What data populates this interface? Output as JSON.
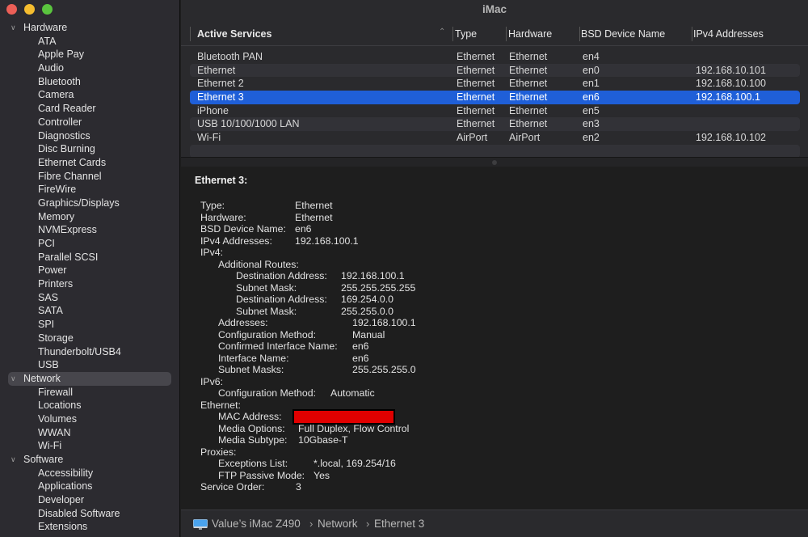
{
  "window": {
    "title": "iMac",
    "traffic_lights": {
      "close": "#ec5f57",
      "minimize": "#f5bd2f",
      "maximize": "#5ac43e"
    }
  },
  "sidebar": {
    "groups": [
      {
        "label": "Hardware",
        "expanded": true,
        "items": [
          "ATA",
          "Apple Pay",
          "Audio",
          "Bluetooth",
          "Camera",
          "Card Reader",
          "Controller",
          "Diagnostics",
          "Disc Burning",
          "Ethernet Cards",
          "Fibre Channel",
          "FireWire",
          "Graphics/Displays",
          "Memory",
          "NVMExpress",
          "PCI",
          "Parallel SCSI",
          "Power",
          "Printers",
          "SAS",
          "SATA",
          "SPI",
          "Storage",
          "Thunderbolt/USB4",
          "USB"
        ]
      },
      {
        "label": "Network",
        "expanded": true,
        "selected": true,
        "items": [
          "Firewall",
          "Locations",
          "Volumes",
          "WWAN",
          "Wi-Fi"
        ]
      },
      {
        "label": "Software",
        "expanded": true,
        "items": [
          "Accessibility",
          "Applications",
          "Developer",
          "Disabled Software",
          "Extensions"
        ]
      }
    ],
    "chevron_icon": "chevron-down-icon"
  },
  "table": {
    "columns": [
      "Active Services",
      "Type",
      "Hardware",
      "BSD Device Name",
      "IPv4 Addresses"
    ],
    "sort_indicator": "⌃",
    "rows": [
      [
        "Bluetooth PAN",
        "Ethernet",
        "Ethernet",
        "en4",
        ""
      ],
      [
        "Ethernet",
        "Ethernet",
        "Ethernet",
        "en0",
        "192.168.10.101"
      ],
      [
        "Ethernet 2",
        "Ethernet",
        "Ethernet",
        "en1",
        "192.168.10.100"
      ],
      [
        "Ethernet 3",
        "Ethernet",
        "Ethernet",
        "en6",
        "192.168.100.1"
      ],
      [
        "iPhone",
        "Ethernet",
        "Ethernet",
        "en5",
        ""
      ],
      [
        "USB 10/100/1000 LAN",
        "Ethernet",
        "Ethernet",
        "en3",
        ""
      ],
      [
        "Wi-Fi",
        "AirPort",
        "AirPort",
        "en2",
        "192.168.10.102"
      ]
    ],
    "selected_row": 3,
    "selection_color": "#1f5fd8"
  },
  "detail": {
    "title": "Ethernet 3:",
    "rows": [
      {
        "indent": 0,
        "key": "Type:",
        "value": "Ethernet",
        "vcol": 0
      },
      {
        "indent": 0,
        "key": "Hardware:",
        "value": "Ethernet",
        "vcol": 0
      },
      {
        "indent": 0,
        "key": "BSD Device Name:",
        "value": "en6",
        "vcol": 0
      },
      {
        "indent": 0,
        "key": "IPv4 Addresses:",
        "value": "192.168.100.1",
        "vcol": 0
      },
      {
        "indent": 0,
        "key": "IPv4:",
        "value": ""
      },
      {
        "indent": 1,
        "key": "Additional Routes:",
        "value": ""
      },
      {
        "indent": 2,
        "key": "Destination Address:",
        "value": "192.168.100.1",
        "vcol": 1
      },
      {
        "indent": 2,
        "key": "Subnet Mask:",
        "value": "255.255.255.255",
        "vcol": 1
      },
      {
        "indent": 2,
        "key": "Destination Address:",
        "value": "169.254.0.0",
        "vcol": 1
      },
      {
        "indent": 2,
        "key": "Subnet Mask:",
        "value": "255.255.0.0",
        "vcol": 1
      },
      {
        "indent": 1,
        "key": "Addresses:",
        "value": "192.168.100.1",
        "vcol": 2
      },
      {
        "indent": 1,
        "key": "Configuration Method:",
        "value": "Manual",
        "vcol": 2
      },
      {
        "indent": 1,
        "key": "Confirmed Interface Name:",
        "value": "en6",
        "vcol": 2
      },
      {
        "indent": 1,
        "key": "Interface Name:",
        "value": "en6",
        "vcol": 2
      },
      {
        "indent": 1,
        "key": "Subnet Masks:",
        "value": "255.255.255.0",
        "vcol": 2
      },
      {
        "indent": 0,
        "key": "IPv6:",
        "value": ""
      },
      {
        "indent": 1,
        "key": "Configuration Method:",
        "value": "Automatic",
        "vcol": 3
      },
      {
        "indent": 0,
        "key": "Ethernet:",
        "value": ""
      },
      {
        "indent": 1,
        "key": "MAC Address:",
        "value": "",
        "redacted": true,
        "vcol": 4
      },
      {
        "indent": 1,
        "key": "Media Options:",
        "value": "Full Duplex, Flow Control",
        "vcol": 5
      },
      {
        "indent": 1,
        "key": "Media Subtype:",
        "value": "10Gbase-T",
        "vcol": 5
      },
      {
        "indent": 0,
        "key": "Proxies:",
        "value": ""
      },
      {
        "indent": 1,
        "key": "Exceptions List:",
        "value": "*.local, 169.254/16",
        "vcol": 6
      },
      {
        "indent": 1,
        "key": "FTP Passive Mode:",
        "value": "Yes",
        "vcol": 6
      },
      {
        "indent": 0,
        "key": "Service Order:",
        "value": "3",
        "vcol": 7
      }
    ],
    "redaction_color": "#e10000"
  },
  "pathbar": {
    "icon": "imac-icon",
    "crumbs": [
      "Value’s iMac Z490",
      "Network",
      "Ethernet 3"
    ],
    "separator": "›"
  }
}
